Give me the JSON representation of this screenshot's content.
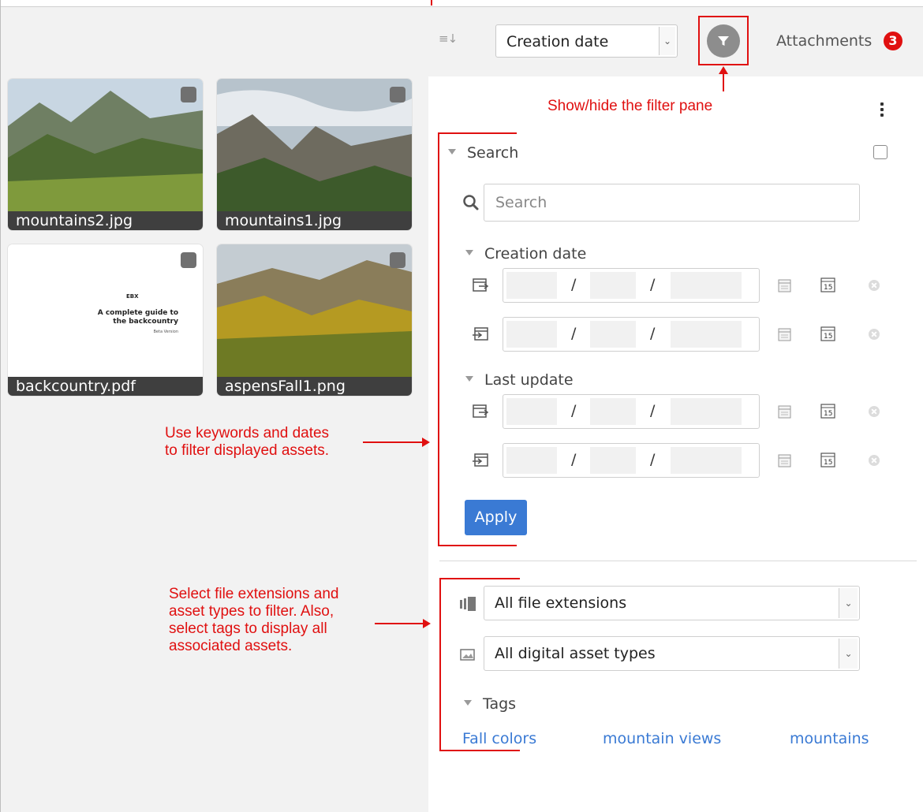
{
  "toolbar": {
    "sort_icon": "sort-descending-icon",
    "sort_select_value": "Creation date",
    "filter_button_icon": "filter-icon",
    "attachments_label": "Attachments",
    "attachments_count": "3"
  },
  "annotations": {
    "filter_pane": "Show/hide the filter pane",
    "keywords_dates_line1": "Use keywords and dates",
    "keywords_dates_line2": "to filter displayed assets.",
    "extensions_line1": "Select file extensions and",
    "extensions_line2": "asset types to filter. Also,",
    "extensions_line3": "select tags to display all",
    "extensions_line4": "associated assets.",
    "color": "#e01010"
  },
  "gallery": {
    "assets": [
      {
        "name": "mountains2.jpg"
      },
      {
        "name": "mountains1.jpg"
      },
      {
        "name": "backcountry.pdf",
        "doc_brand": "EBX",
        "doc_title_line1": "A complete guide to",
        "doc_title_line2": "the backcountry",
        "doc_subtitle": "Beta Version"
      },
      {
        "name": "aspensFall1.png"
      }
    ]
  },
  "filter_pane": {
    "search_section": {
      "title": "Search",
      "search_placeholder": "Search",
      "creation_date_title": "Creation date",
      "last_update_title": "Last update",
      "date_separator": "/",
      "today_icon_text": "15",
      "apply_label": "Apply"
    },
    "extensions_select_value": "All file extensions",
    "asset_types_select_value": "All digital asset types",
    "tags_title": "Tags",
    "tags": [
      "Fall colors",
      "mountain views",
      "mountains"
    ]
  },
  "colors": {
    "accent": "#3a7ad4",
    "badge": "#e01010",
    "filter_button": "#8d8d8d"
  }
}
